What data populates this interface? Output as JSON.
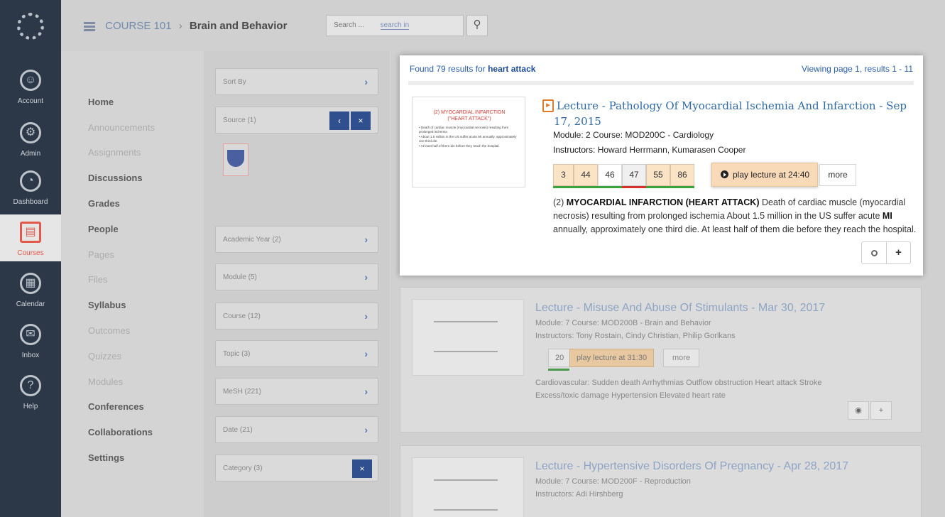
{
  "course_nav": {
    "items": [
      {
        "label": "",
        "dim": true
      },
      {
        "label": "Home",
        "dim": false
      },
      {
        "label": "Announcements",
        "dim": true
      },
      {
        "label": "Assignments",
        "dim": true
      },
      {
        "label": "Discussions",
        "dim": false
      },
      {
        "label": "Grades",
        "dim": false
      },
      {
        "label": "People",
        "dim": false
      },
      {
        "label": "Pages",
        "dim": true
      },
      {
        "label": "Files",
        "dim": true
      },
      {
        "label": "Syllabus",
        "dim": false
      },
      {
        "label": "Outcomes",
        "dim": true
      },
      {
        "label": "Quizzes",
        "dim": true
      },
      {
        "label": "Modules",
        "dim": true
      },
      {
        "label": "Conferences",
        "dim": false
      },
      {
        "label": "Collaborations",
        "dim": false
      },
      {
        "label": "Settings",
        "dim": false
      }
    ]
  },
  "global_nav": {
    "items": [
      {
        "label": "Account",
        "icon": "account-icon",
        "glyph": "☺"
      },
      {
        "label": "Admin",
        "icon": "admin-icon",
        "glyph": "⚙"
      },
      {
        "label": "Dashboard",
        "icon": "dashboard-icon",
        "glyph": "◔"
      },
      {
        "label": "Courses",
        "icon": "courses-icon",
        "glyph": "▤",
        "active": true
      },
      {
        "label": "Calendar",
        "icon": "calendar-icon",
        "glyph": "▦"
      },
      {
        "label": "Inbox",
        "icon": "inbox-icon",
        "glyph": "✉"
      },
      {
        "label": "Help",
        "icon": "help-icon",
        "glyph": "?"
      }
    ]
  },
  "header": {
    "course": "COURSE 101",
    "separator": "›",
    "title": "Brain and Behavior",
    "search_placeholder": "Search ...",
    "search_scope": "search in"
  },
  "facets": {
    "sort_label": "Sort By",
    "source_label": "Source (1)",
    "items": [
      {
        "label": "Academic Year (2)"
      },
      {
        "label": "Module (5)"
      },
      {
        "label": "Course (12)"
      },
      {
        "label": "Topic (3)"
      },
      {
        "label": "MeSH (221)"
      },
      {
        "label": "Date (21)"
      },
      {
        "label": "Category (3)"
      }
    ]
  },
  "popup": {
    "found_prefix": "Found 79 results for",
    "query": "heart attack",
    "viewing": "Viewing page 1, results 1 - 11",
    "slide": {
      "title_line1": "(2) MYOCARDIAL INFARCTION",
      "title_line2": "(\"HEART ATTACK\")",
      "bullets": [
        "• Death of cardiac muscle (myocardial necrosis) resulting from prolonged ischemia",
        "• About 1.5 million in the US suffer acute MI annually, approximately one third die.",
        "• At least half of them die before they reach the hospital."
      ]
    },
    "lecture_title_line1": "Lecture - Pathology Of Myocardial Ischemia And Infarction - Sep",
    "lecture_title_line2": "17, 2015",
    "module_line": "Module: 2 Course: MOD200C - Cardiology",
    "instructors_label": "Instructors:",
    "instructors": "Howard Herrmann, Kumarasen Cooper",
    "segments": [
      {
        "label": "3",
        "style": "hit",
        "bar": "#3aa33a"
      },
      {
        "label": "44",
        "style": "hit",
        "bar": "#3aa33a"
      },
      {
        "label": "46",
        "style": "plain",
        "bar": "#3aa33a"
      },
      {
        "label": "47",
        "style": "current",
        "bar": "#d9302c"
      },
      {
        "label": "55",
        "style": "hit",
        "bar": "#3aa33a"
      },
      {
        "label": "86",
        "style": "hit",
        "bar": "#3aa33a"
      }
    ],
    "play_label": "play lecture at 24:40",
    "more_label": "more",
    "snippet_prefix": "(2)",
    "snippet_bold1": "MYOCARDIAL INFARCTION (HEART ATTACK)",
    "snippet_mid": "Death of cardiac muscle (myocardial necrosis) resulting from prolonged ischemia About 1.5 million in the US suffer acute",
    "snippet_bold2": "MI",
    "snippet_end": "annually, approximately one third die. At least half of them die before they reach the hospital."
  },
  "bg_results": [
    {
      "title": "Lecture - Misuse And Abuse Of Stimulants - Mar 30, 2017",
      "module": "Module: 7 Course: MOD200B - Brain and Behavior",
      "instructors": "Instructors: Tony Rostain, Cindy Christian, Philip Gorlkans",
      "segment": "20",
      "play": "play lecture at 31:30",
      "more": "more",
      "snippet1": "Cardiovascular: Sudden death Arrhythmias Outflow obstruction Heart attack Stroke",
      "snippet2": "Excess/toxic damage Hypertension Elevated heart rate"
    },
    {
      "title": "Lecture - Hypertensive Disorders Of Pregnancy - Apr 28, 2017",
      "module": "Module: 7 Course: MOD200F - Reproduction",
      "instructors": "Instructors: Adi Hirshberg"
    }
  ]
}
